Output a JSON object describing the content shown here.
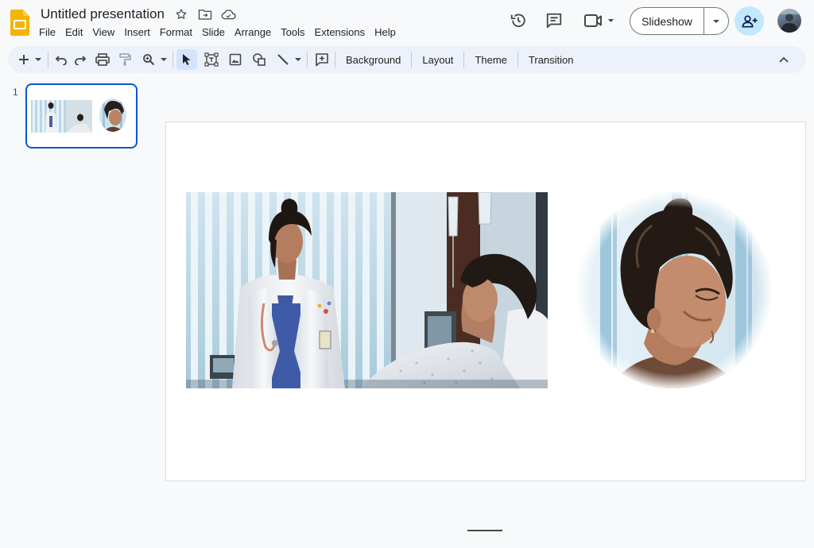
{
  "header": {
    "doc_title": "Untitled presentation",
    "menu": [
      "File",
      "Edit",
      "View",
      "Insert",
      "Format",
      "Slide",
      "Arrange",
      "Tools",
      "Extensions",
      "Help"
    ],
    "slideshow_label": "Slideshow"
  },
  "toolbar": {
    "background_label": "Background",
    "layout_label": "Layout",
    "theme_label": "Theme",
    "transition_label": "Transition"
  },
  "filmstrip": {
    "slide_number": "1"
  },
  "icons": {
    "logo": "slides-logo",
    "star": "star-icon",
    "folder": "move-folder-icon",
    "cloud": "cloud-status-icon",
    "history": "version-history-icon",
    "comments": "comments-icon",
    "meet": "video-call-icon",
    "share": "share-person-add-icon"
  },
  "colors": {
    "accent": "#0b57d0",
    "share_bg": "#c2e7ff",
    "toolbar_bg": "#edf2fa",
    "logo": "#f4b400"
  }
}
